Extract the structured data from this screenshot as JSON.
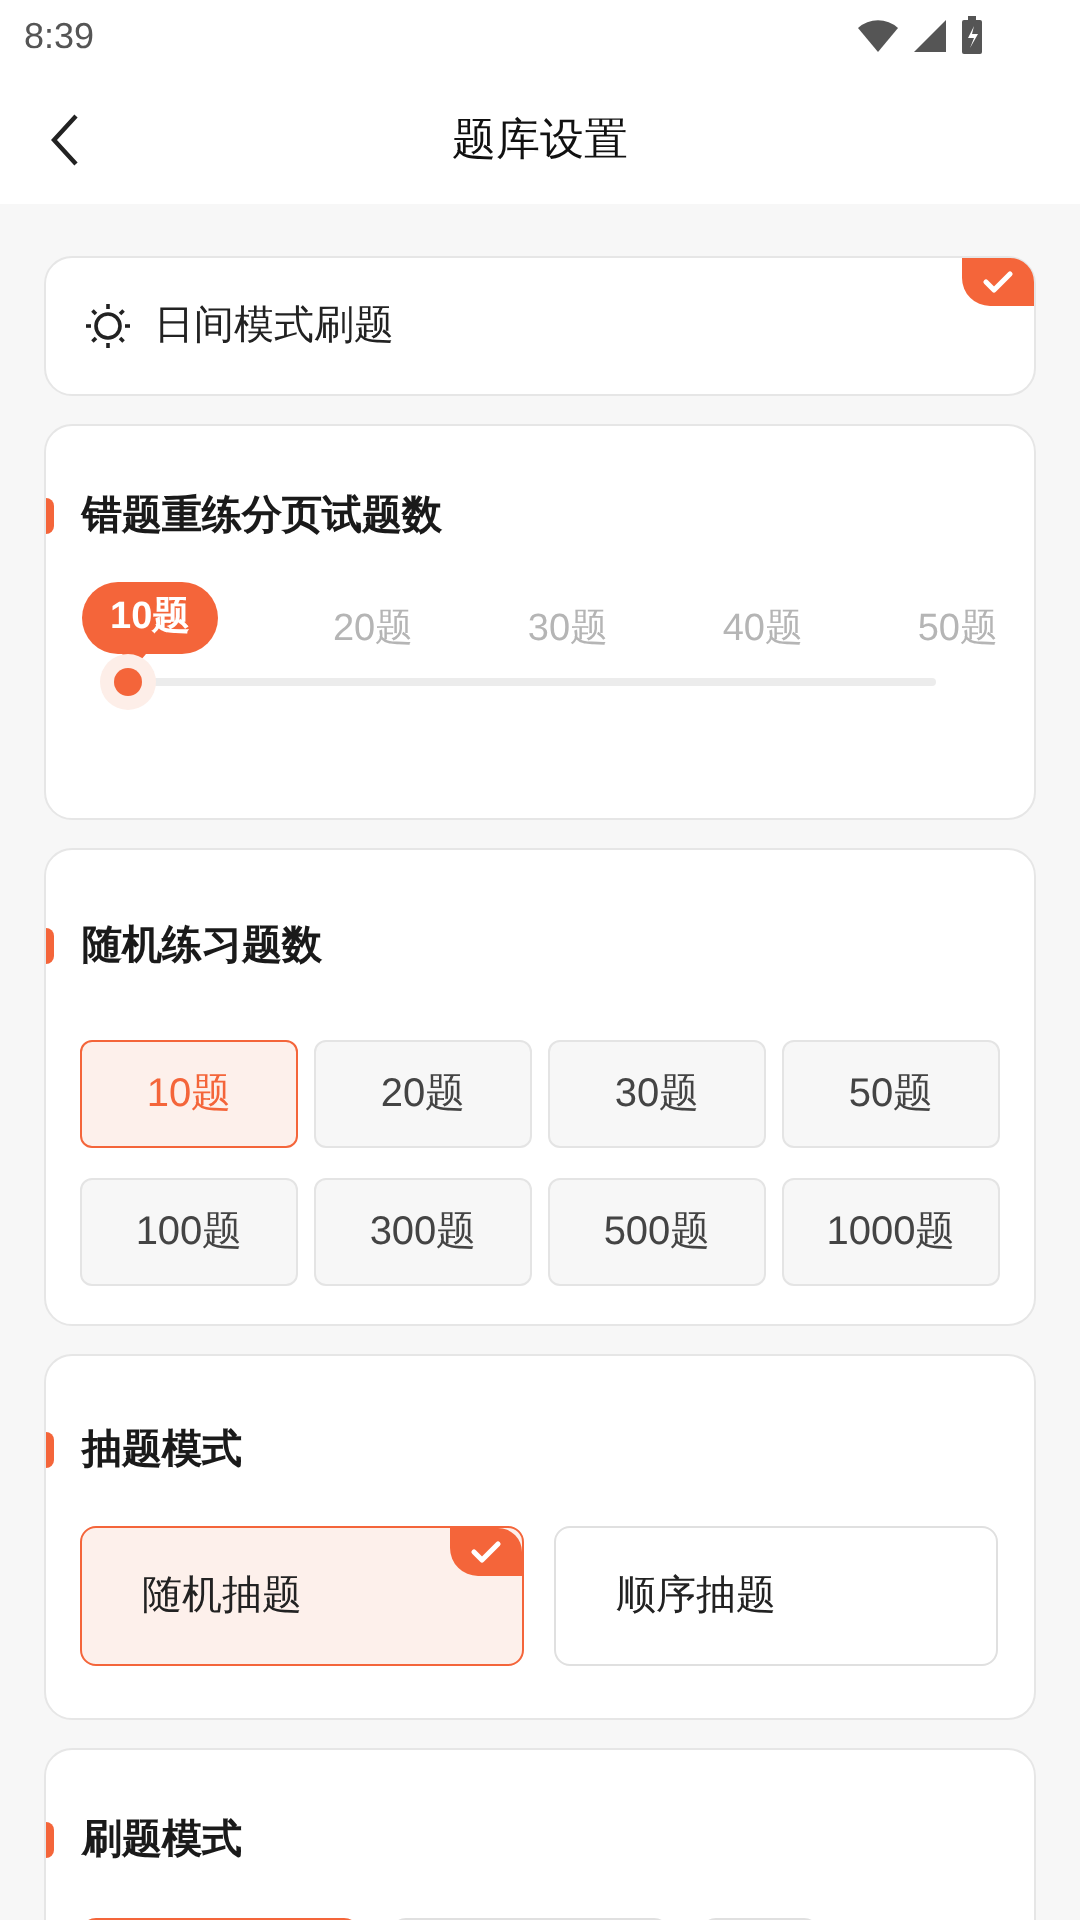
{
  "status_bar": {
    "time": "8:39"
  },
  "header": {
    "title": "题库设置"
  },
  "day_mode": {
    "label": "日间模式刷题",
    "checked": true
  },
  "wrong_retry": {
    "title": "错题重练分页试题数",
    "marks": [
      {
        "label": "10题",
        "selected": true
      },
      {
        "label": "20题",
        "selected": false
      },
      {
        "label": "30题",
        "selected": false
      },
      {
        "label": "40题",
        "selected": false
      },
      {
        "label": "50题",
        "selected": false
      }
    ]
  },
  "random_count": {
    "title": "随机练习题数",
    "options": [
      {
        "label": "10题",
        "selected": true
      },
      {
        "label": "20题",
        "selected": false
      },
      {
        "label": "30题",
        "selected": false
      },
      {
        "label": "50题",
        "selected": false
      },
      {
        "label": "100题",
        "selected": false
      },
      {
        "label": "300题",
        "selected": false
      },
      {
        "label": "500题",
        "selected": false
      },
      {
        "label": "1000题",
        "selected": false
      }
    ]
  },
  "draw_mode": {
    "title": "抽题模式",
    "options": [
      {
        "label": "随机抽题",
        "selected": true
      },
      {
        "label": "顺序抽题",
        "selected": false
      }
    ]
  },
  "practice_mode": {
    "title": "刷题模式",
    "options": [
      {
        "selected": true
      },
      {
        "selected": false
      },
      {
        "selected": false
      }
    ]
  }
}
